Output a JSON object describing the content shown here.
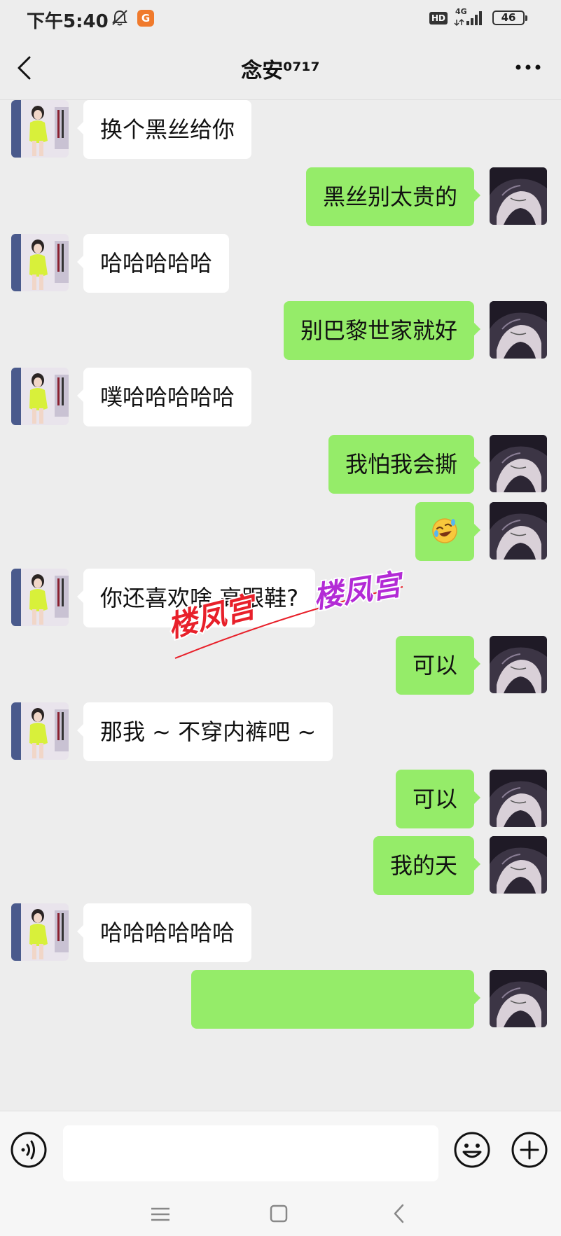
{
  "status_bar": {
    "time": "下午5:40",
    "app_badge": "G",
    "hd": "HD",
    "network": "4G",
    "battery": "46"
  },
  "header": {
    "title": "念安⁰⁷¹⁷"
  },
  "messages": [
    {
      "side": "in",
      "text": "换个黑丝给你"
    },
    {
      "side": "out",
      "text": "黑丝别太贵的"
    },
    {
      "side": "in",
      "text": "哈哈哈哈哈"
    },
    {
      "side": "out",
      "text": "别巴黎世家就好"
    },
    {
      "side": "in",
      "text": "噗哈哈哈哈哈"
    },
    {
      "side": "out",
      "text": "我怕我会撕"
    },
    {
      "side": "out",
      "text": "",
      "emoji": "rolling-on-floor-laughing"
    },
    {
      "side": "in",
      "text": "你还喜欢啥 高跟鞋?"
    },
    {
      "side": "out",
      "text": "可以"
    },
    {
      "side": "in",
      "text": "那我 ~ 不穿内裤吧 ~"
    },
    {
      "side": "out",
      "text": "可以"
    },
    {
      "side": "out",
      "text": "我的天"
    },
    {
      "side": "in",
      "text": "哈哈哈哈哈哈"
    },
    {
      "side": "out",
      "text": ""
    }
  ],
  "watermark": {
    "left_text": "楼凤宫",
    "right_text": "楼凤宫",
    "left_color": "#e8202a",
    "right_color": "#b32bd6",
    "line_color": "#e8202a"
  },
  "input_bar": {
    "placeholder": "",
    "icons": [
      "voice-icon",
      "emoji-icon",
      "plus-icon"
    ]
  },
  "colors": {
    "background": "#ededed",
    "outgoing_bubble": "#95ec69",
    "incoming_bubble": "#ffffff"
  }
}
